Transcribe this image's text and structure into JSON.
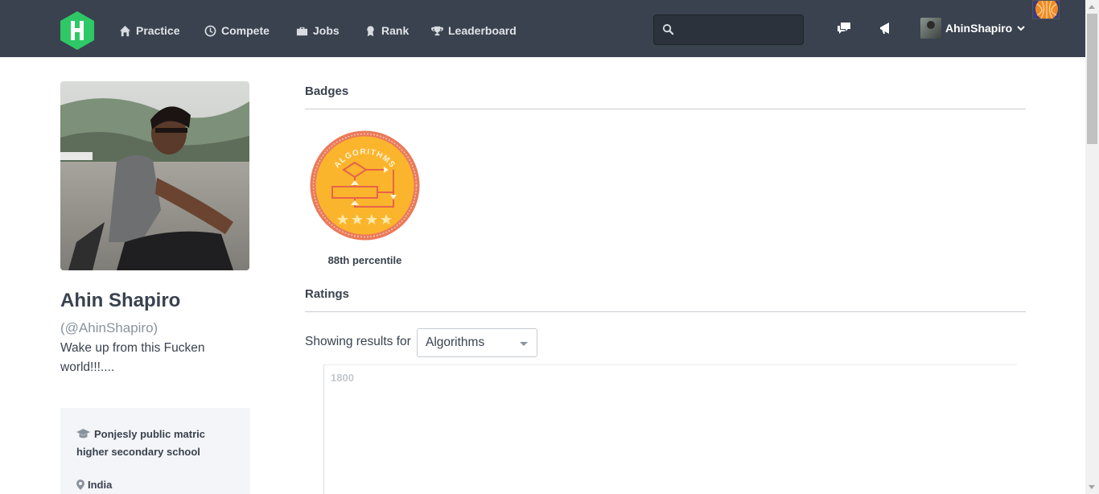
{
  "nav": {
    "items": [
      {
        "label": "Practice",
        "icon": "home-icon"
      },
      {
        "label": "Compete",
        "icon": "clock-icon"
      },
      {
        "label": "Jobs",
        "icon": "briefcase-icon"
      },
      {
        "label": "Rank",
        "icon": "ribbon-icon"
      },
      {
        "label": "Leaderboard",
        "icon": "trophy-icon"
      }
    ],
    "search_placeholder": "",
    "username": "AhinShapiro"
  },
  "profile": {
    "name": "Ahin Shapiro",
    "handle": "(@AhinShapiro)",
    "bio": "Wake up from this Fucken world!!!....",
    "school": "Ponjesly public matric higher secondary school",
    "country": "India"
  },
  "badges": {
    "title": "Badges",
    "items": [
      {
        "name": "ALGORITHMS",
        "label": "88th percentile",
        "stars": 4
      }
    ]
  },
  "ratings": {
    "title": "Ratings",
    "showing_label": "Showing results for",
    "selected": "Algorithms",
    "y_tick": "1800"
  },
  "colors": {
    "nav_bg": "#39424e",
    "brand_green": "#2ec866",
    "badge_orange": "#f5a623",
    "badge_ring": "#ea7a5b"
  }
}
